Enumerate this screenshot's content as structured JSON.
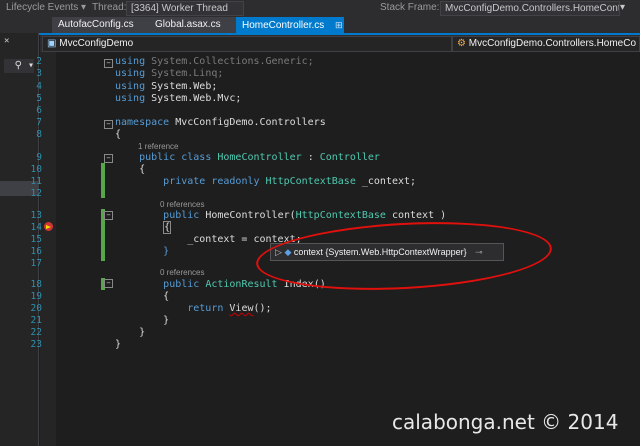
{
  "debugbar": {
    "events_label": "Lifecycle Events ▾",
    "thread_label": "Thread:",
    "thread_value": "[3364] Worker Thread",
    "stackframe_label": "Stack Frame:",
    "stackframe_value": "MvcConfigDemo.Controllers.HomeContr"
  },
  "tabs": [
    {
      "label": "AutofacConfig.cs",
      "state": "inactive"
    },
    {
      "label": "Global.asax.cs",
      "state": "inactive"
    },
    {
      "label": "HomeController.cs",
      "state": "active"
    }
  ],
  "navbar": {
    "project": "MvcConfigDemo",
    "type": "MvcConfigDemo.Controllers.HomeCo"
  },
  "code_lines": [
    {
      "num": "2",
      "text": "using System.Collections.Generic;"
    },
    {
      "num": "3",
      "text": "using System.Linq;"
    },
    {
      "num": "4",
      "text": "using System.Web;"
    },
    {
      "num": "5",
      "text": "using System.Web.Mvc;"
    },
    {
      "num": "6",
      "text": ""
    },
    {
      "num": "7",
      "text": "namespace MvcConfigDemo.Controllers"
    },
    {
      "num": "8",
      "text": "{"
    },
    {
      "num": "9",
      "text": "    public class HomeController : Controller"
    },
    {
      "num": "10",
      "text": "    {"
    },
    {
      "num": "11",
      "text": "        private readonly HttpContextBase _context;"
    },
    {
      "num": "12",
      "text": ""
    },
    {
      "num": "13",
      "text": "        public HomeController(HttpContextBase context )"
    },
    {
      "num": "14",
      "text": "        {"
    },
    {
      "num": "15",
      "text": "            _context = context;"
    },
    {
      "num": "16",
      "text": "        }"
    },
    {
      "num": "17",
      "text": ""
    },
    {
      "num": "18",
      "text": "        public ActionResult Index()"
    },
    {
      "num": "19",
      "text": "        {"
    },
    {
      "num": "20",
      "text": "            return View();"
    },
    {
      "num": "21",
      "text": "        }"
    },
    {
      "num": "22",
      "text": "    }"
    },
    {
      "num": "23",
      "text": "}"
    }
  ],
  "references": {
    "class_ref": "1 reference",
    "ctor_ref": "0 references",
    "index_ref": "0 references"
  },
  "tooltip": {
    "text": "context  {System.Web.HttpContextWrapper}"
  },
  "watermark": "calabonga.net © 2014",
  "colors": {
    "active_tab": "#007acc",
    "annotation": "#e0100d",
    "keyword": "#569cd6",
    "type": "#4ec9b0",
    "line_number": "#2b91af"
  }
}
